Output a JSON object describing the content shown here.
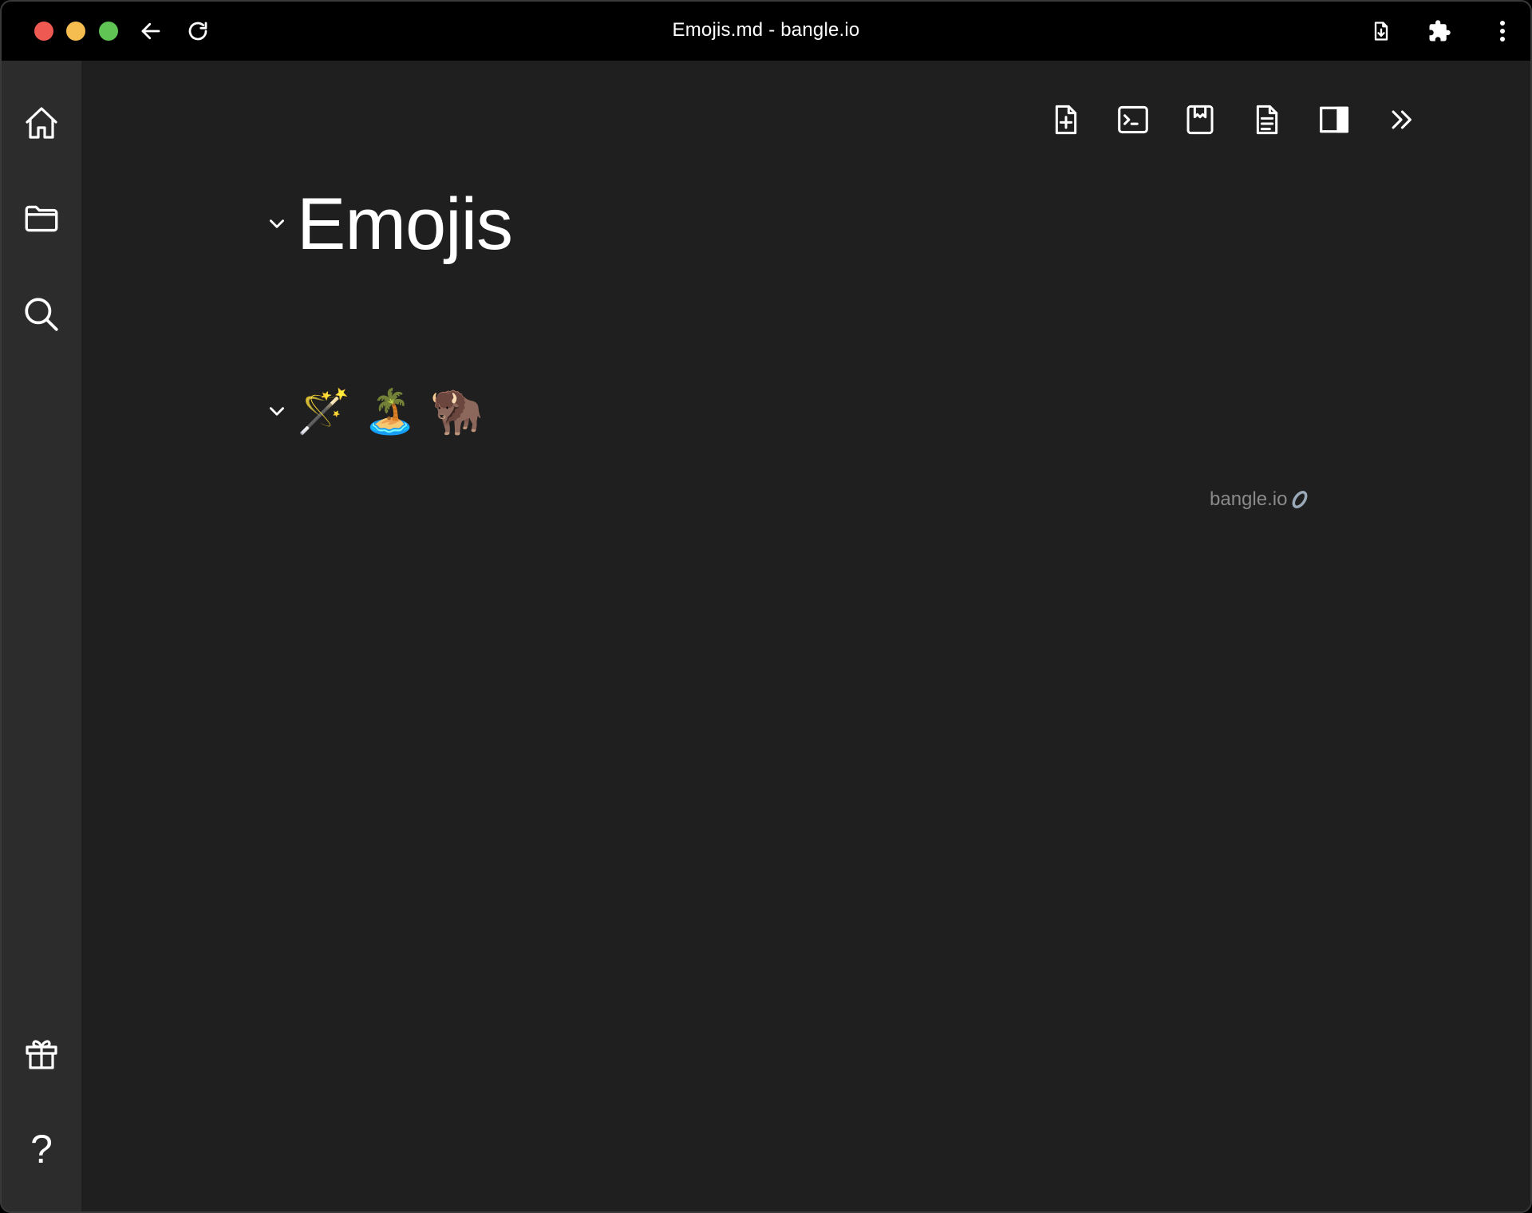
{
  "window": {
    "title": "Emojis.md - bangle.io"
  },
  "titlebar": {
    "traffic_lights": [
      "close",
      "minimize",
      "maximize"
    ],
    "nav_icons": [
      "arrow-left-icon",
      "reload-icon"
    ],
    "right_icons": [
      "file-download-icon",
      "puzzle-extension-icon",
      "kebab-menu-icon"
    ]
  },
  "sidebar": {
    "top_items": [
      "home-icon",
      "folder-icon",
      "search-icon"
    ],
    "bottom_items": [
      "gift-icon",
      "help-icon"
    ],
    "help_glyph": "?"
  },
  "toolbar": {
    "items": [
      "new-note-icon",
      "command-palette-icon",
      "bookmark-note-icon",
      "note-outline-icon",
      "split-screen-icon",
      "collapse-sidebar-icon"
    ]
  },
  "document": {
    "heading": "Emojis",
    "paragraph": "🪄🏝️🦬"
  },
  "watermark": {
    "text": "bangle.io"
  },
  "colors": {
    "titlebar_bg": "#000000",
    "sidebar_bg": "#2c2c2c",
    "editor_bg": "#1f1f1f",
    "text": "#ffffff",
    "muted_text": "#8a8a8a",
    "traffic_close": "#ee5a52",
    "traffic_minimize": "#f5bd4f",
    "traffic_maximize": "#5fc454"
  }
}
